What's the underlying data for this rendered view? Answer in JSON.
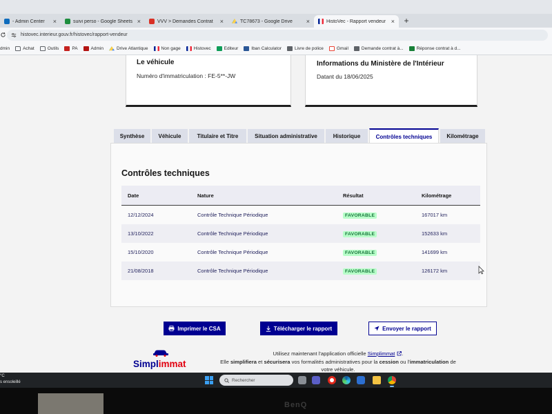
{
  "browser": {
    "tabs": [
      {
        "label": "- Admin Center",
        "icon": "admin-center-icon"
      },
      {
        "label": "suivi perso - Google Sheets",
        "icon": "google-sheets-icon"
      },
      {
        "label": "VVV > Demandes Contrat",
        "icon": "vvv-icon"
      },
      {
        "label": "TC78673 - Google Drive",
        "icon": "google-drive-icon"
      },
      {
        "label": "HistoVec - Rapport vendeur",
        "icon": "french-flag-icon",
        "active": true
      }
    ],
    "close_glyph": "×",
    "new_tab_glyph": "+",
    "address": "histovec.interieur.gouv.fr/histovec/rapport-vendeur",
    "bookmarks": [
      {
        "label": "dmin",
        "icon": "admin-icon"
      },
      {
        "label": "Achat",
        "icon": "folder-icon"
      },
      {
        "label": "Outils",
        "icon": "folder-icon"
      },
      {
        "label": "PA",
        "icon": "pa-icon"
      },
      {
        "label": "Admin",
        "icon": "admin-icon"
      },
      {
        "label": "Drive Atlantique",
        "icon": "google-drive-icon"
      },
      {
        "label": "Non gage",
        "icon": "french-flag-icon"
      },
      {
        "label": "Histovec",
        "icon": "french-flag-icon"
      },
      {
        "label": "Editeur",
        "icon": "editor-icon"
      },
      {
        "label": "Iban Calculator",
        "icon": "iban-icon"
      },
      {
        "label": "Livre de police",
        "icon": "document-icon"
      },
      {
        "label": "Gmail",
        "icon": "gmail-icon"
      },
      {
        "label": "Demande contrat à...",
        "icon": "document-icon"
      },
      {
        "label": "Réponse contrat à d...",
        "icon": "sheet-icon"
      }
    ]
  },
  "vehicle_card": {
    "title": "Le véhicule",
    "plate": "Numéro d'immatriculation : FE-5**-JW"
  },
  "ministry_card": {
    "title": "Informations du Ministère de l'Intérieur",
    "date": "Datant du 18/06/2025"
  },
  "report_tabs": [
    "Synthèse",
    "Véhicule",
    "Titulaire et Titre",
    "Situation administrative",
    "Historique",
    "Contrôles techniques",
    "Kilométrage"
  ],
  "active_report_tab": "Contrôles techniques",
  "inspections": {
    "title": "Contrôles techniques",
    "columns": [
      "Date",
      "Nature",
      "Résultat",
      "Kilométrage"
    ],
    "rows": [
      {
        "date": "12/12/2024",
        "nature": "Contrôle Technique Périodique",
        "result": "FAVORABLE",
        "mileage": "167017 km"
      },
      {
        "date": "13/10/2022",
        "nature": "Contrôle Technique Périodique",
        "result": "FAVORABLE",
        "mileage": "152633 km"
      },
      {
        "date": "15/10/2020",
        "nature": "Contrôle Technique Périodique",
        "result": "FAVORABLE",
        "mileage": "141699 km"
      },
      {
        "date": "21/08/2018",
        "nature": "Contrôle Technique Périodique",
        "result": "FAVORABLE",
        "mileage": "126172 km"
      }
    ]
  },
  "actions": {
    "print": "Imprimer le CSA",
    "download": "Télécharger le rapport",
    "send": "Envoyer le rapport"
  },
  "simplimmat": {
    "logo_part1": "Simpl",
    "logo_part2": "immat",
    "line1_text": "Utilisez maintenant l'application officielle ",
    "link_text": "Simplimmat",
    "line1_end": ".",
    "line2": [
      {
        "t": "Elle ",
        "b": false
      },
      {
        "t": "simplifiera",
        "b": true
      },
      {
        "t": " et ",
        "b": false
      },
      {
        "t": "sécurisera",
        "b": true
      },
      {
        "t": " vos formalités administratives pour la ",
        "b": false
      },
      {
        "t": "cession",
        "b": true
      },
      {
        "t": " ou l'",
        "b": false
      },
      {
        "t": "immatriculation",
        "b": true
      },
      {
        "t": " de",
        "b": false
      }
    ],
    "line3": "votre véhicule."
  },
  "taskbar": {
    "weather_temp": "°C",
    "weather_desc": "s ensoleillé",
    "search_placeholder": "Rechercher",
    "apps": [
      "widgets-icon",
      "teams-icon",
      "opera-icon",
      "edge-icon",
      "store-icon",
      "file-explorer-icon",
      "chrome-icon"
    ]
  },
  "monitor": {
    "brand": "BenQ"
  },
  "colors": {
    "accent": "#000091",
    "badge_bg": "#b8fec9",
    "badge_text": "#18753c",
    "logo_red": "#e1000f"
  }
}
